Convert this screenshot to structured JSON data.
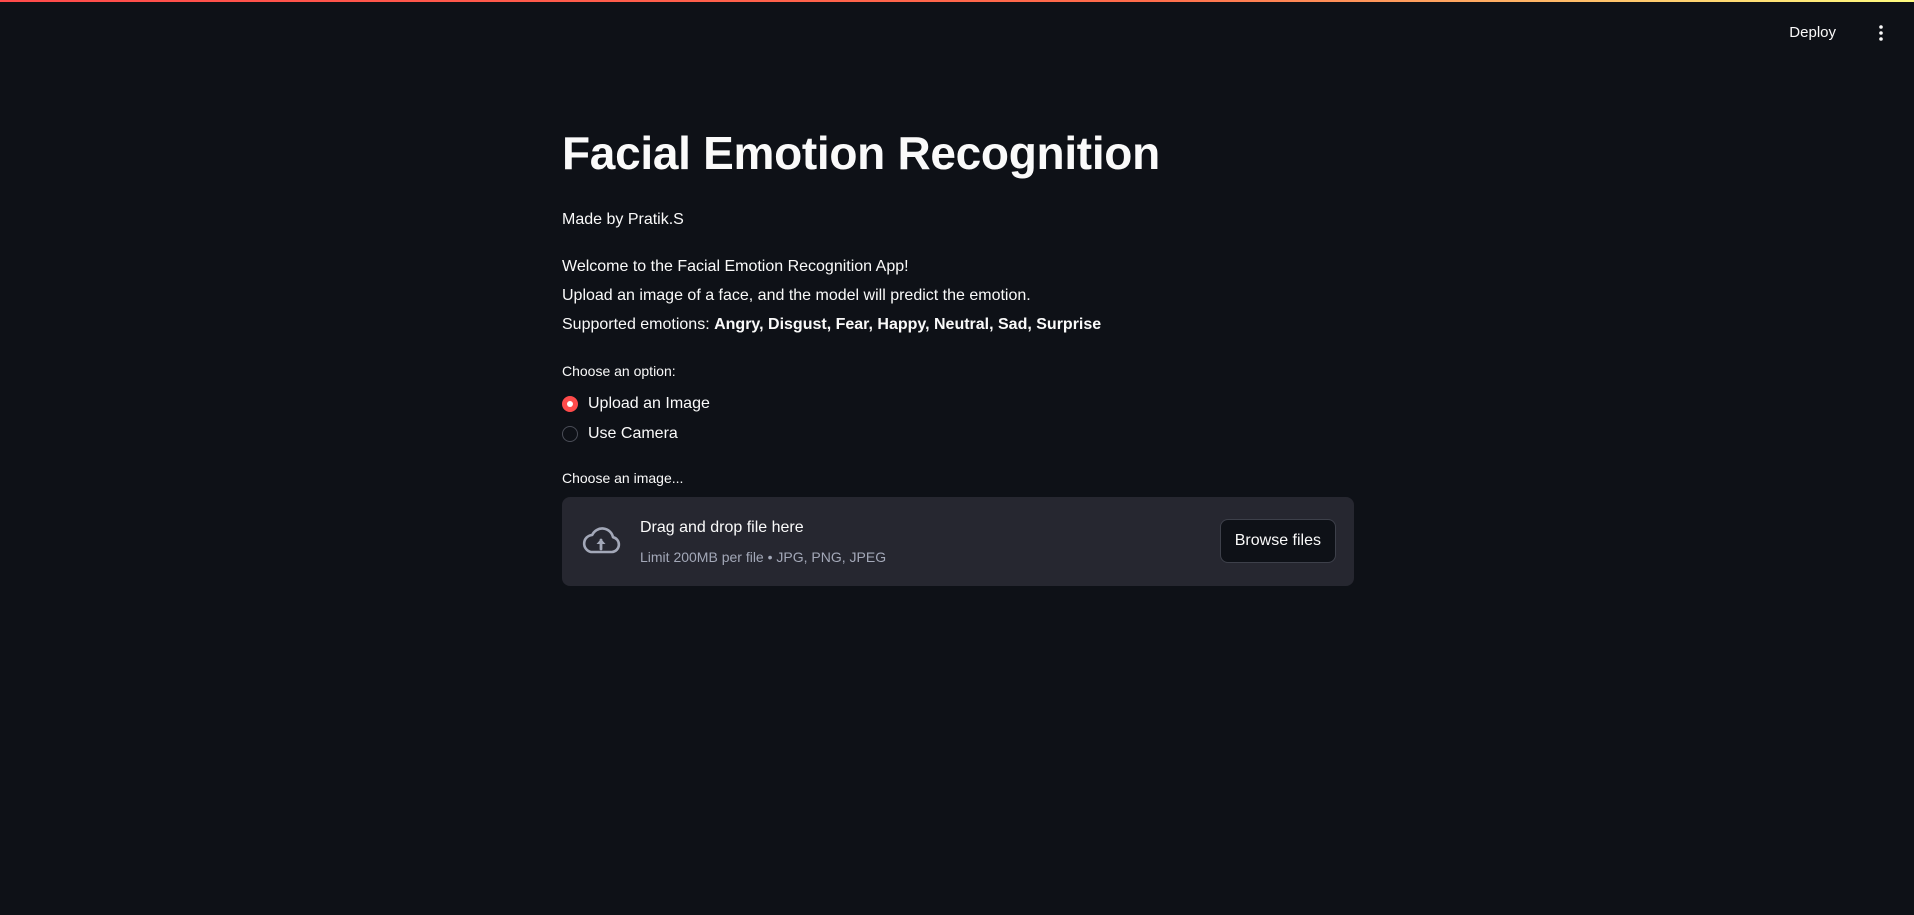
{
  "header": {
    "deploy_label": "Deploy",
    "menu_icon": "vertical-ellipsis-icon"
  },
  "main": {
    "title": "Facial Emotion Recognition",
    "author": "Made by Pratik.S",
    "welcome": "Welcome to the Facial Emotion Recognition App!",
    "instructions": "Upload an image of a face, and the model will predict the emotion.",
    "supported_prefix": "Supported emotions: ",
    "supported_list": "Angry, Disgust, Fear, Happy, Neutral, Sad, Surprise"
  },
  "option_radio": {
    "label": "Choose an option:",
    "options": [
      {
        "label": "Upload an Image",
        "selected": true
      },
      {
        "label": "Use Camera",
        "selected": false
      }
    ]
  },
  "uploader": {
    "label": "Choose an image...",
    "icon": "cloud-upload-icon",
    "drop_text": "Drag and drop file here",
    "limit_text": "Limit 200MB per file • JPG, PNG, JPEG",
    "browse_label": "Browse files"
  },
  "colors": {
    "background": "#0e1117",
    "accent": "#ff4b4b",
    "dropzone": "#262730",
    "text": "#fafafa",
    "muted_text": "#a3a8b8"
  }
}
